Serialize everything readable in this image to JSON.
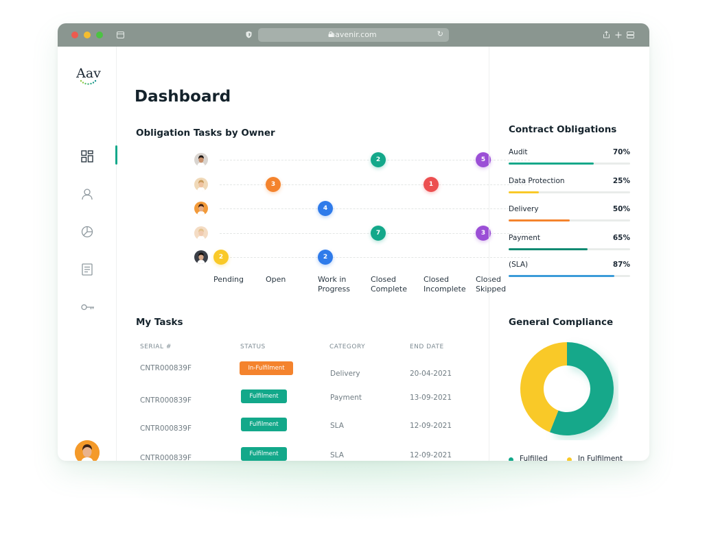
{
  "browser": {
    "url": "aavenir.com"
  },
  "brand": {
    "logo_text": "Aav",
    "accent": "#13a88a"
  },
  "sidebar": {
    "items": [
      {
        "name": "dashboard",
        "icon": "grid-icon",
        "active": true
      },
      {
        "name": "users",
        "icon": "user-icon",
        "active": false
      },
      {
        "name": "reports",
        "icon": "pie-chart-icon",
        "active": false
      },
      {
        "name": "documents",
        "icon": "document-icon",
        "active": false
      },
      {
        "name": "keys",
        "icon": "key-icon",
        "active": false
      }
    ]
  },
  "page": {
    "title": "Dashboard"
  },
  "obligation_tasks": {
    "title": "Obligation Tasks by Owner",
    "columns": [
      "Pending",
      "Open",
      "Work in\nProgress",
      "Closed\nComplete",
      "Closed\nIncomplete",
      "Closed\nSkipped"
    ],
    "rows": [
      {
        "owner": "owner-1",
        "tasks": [
          {
            "column": 3,
            "count": "2",
            "color": "#13a88a"
          },
          {
            "column": 5,
            "count": "5",
            "color": "#9b4fd6"
          }
        ]
      },
      {
        "owner": "owner-2",
        "tasks": [
          {
            "column": 1,
            "count": "3",
            "color": "#f4832d"
          },
          {
            "column": 4,
            "count": "1",
            "color": "#ec4f50"
          }
        ]
      },
      {
        "owner": "owner-3",
        "tasks": [
          {
            "column": 2,
            "count": "4",
            "color": "#2f7bea"
          }
        ]
      },
      {
        "owner": "owner-4",
        "tasks": [
          {
            "column": 3,
            "count": "7",
            "color": "#13a88a"
          },
          {
            "column": 5,
            "count": "3",
            "color": "#9b4fd6"
          }
        ]
      },
      {
        "owner": "owner-5",
        "tasks": [
          {
            "column": 0,
            "count": "2",
            "color": "#f9c928"
          },
          {
            "column": 2,
            "count": "2",
            "color": "#2f7bea"
          }
        ]
      }
    ]
  },
  "my_tasks": {
    "title": "My Tasks",
    "headers": {
      "serial": "SERIAL #",
      "status": "STATUS",
      "category": "CATEGORY",
      "end_date": "END DATE"
    },
    "rows": [
      {
        "serial": "CNTR000839F",
        "status": "In-Fulfilment",
        "status_color": "#f4832d",
        "category": "Delivery",
        "end_date": "20-04-2021"
      },
      {
        "serial": "CNTR000839F",
        "status": "Fulfilment",
        "status_color": "#13a88a",
        "category": "Payment",
        "end_date": "13-09-2021"
      },
      {
        "serial": "CNTR000839F",
        "status": "Fulfilment",
        "status_color": "#13a88a",
        "category": "SLA",
        "end_date": "12-09-2021"
      },
      {
        "serial": "CNTR000839F",
        "status": "Fulfilment",
        "status_color": "#13a88a",
        "category": "SLA",
        "end_date": "12-09-2021"
      }
    ]
  },
  "contract_obligations": {
    "title": "Contract Obligations",
    "items": [
      {
        "label": "Audit",
        "percent": "70%",
        "value": 0.7,
        "color": "#13a88a"
      },
      {
        "label": "Data Protection",
        "percent": "25%",
        "value": 0.25,
        "color": "#f9c928"
      },
      {
        "label": "Delivery",
        "percent": "50%",
        "value": 0.5,
        "color": "#f4832d"
      },
      {
        "label": "Payment",
        "percent": "65%",
        "value": 0.65,
        "color": "#0f8a72"
      },
      {
        "label": "(SLA)",
        "percent": "87%",
        "value": 0.87,
        "color": "#3a9bd8"
      }
    ]
  },
  "general_compliance": {
    "title": "General Compliance",
    "series": [
      {
        "name": "Fulfilled",
        "value": 0.56,
        "color": "#13a88a"
      },
      {
        "name": "In Fulfilment",
        "value": 0.44,
        "color": "#f9c928"
      }
    ]
  }
}
